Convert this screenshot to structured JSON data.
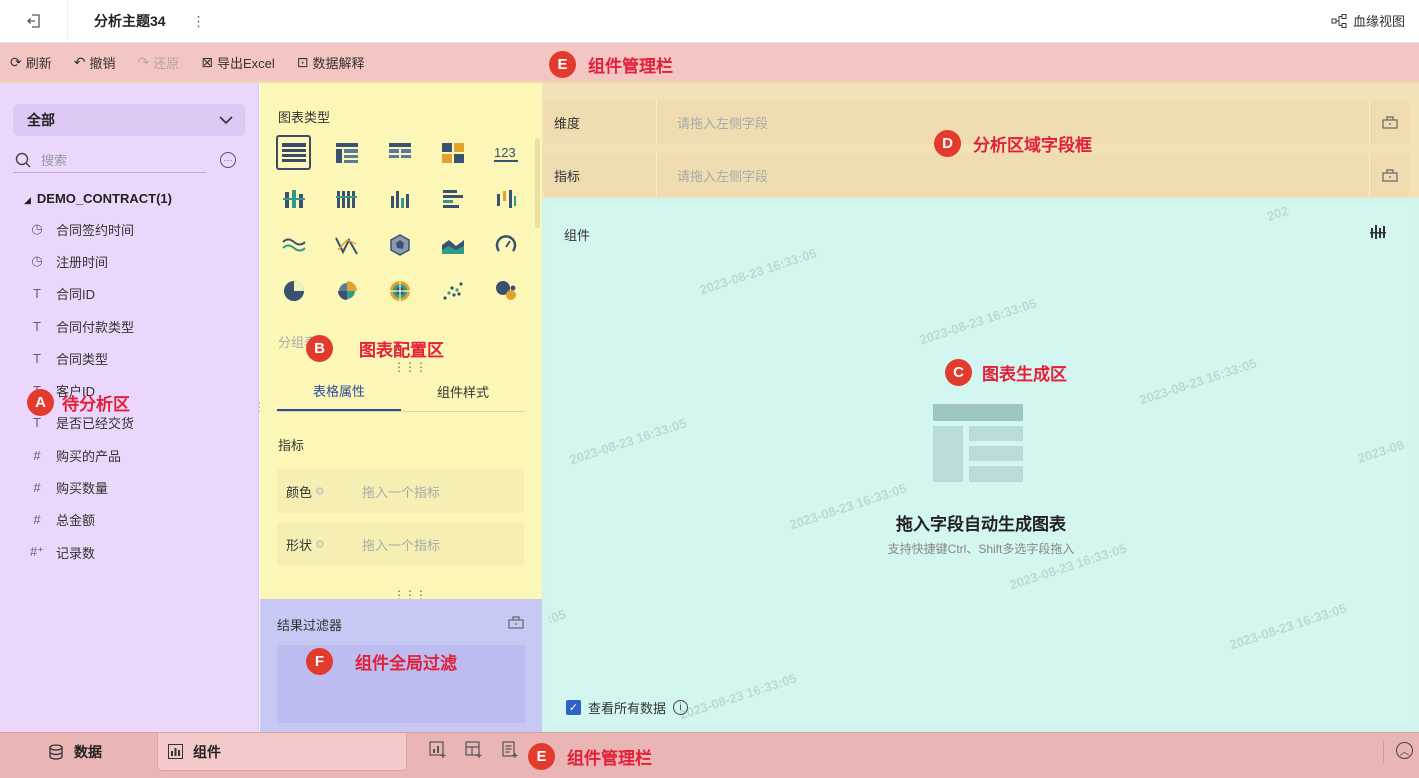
{
  "titlebar": {
    "title": "分析主题34",
    "more": "⋮",
    "lineage_label": "血缘视图"
  },
  "toolbar": {
    "items": [
      {
        "label": "刷新",
        "icon": "refresh-icon",
        "enabled": true
      },
      {
        "label": "撤销",
        "icon": "undo-icon",
        "enabled": true
      },
      {
        "label": "还原",
        "icon": "redo-icon",
        "enabled": false
      },
      {
        "label": "导出Excel",
        "icon": "excel-icon",
        "enabled": true
      },
      {
        "label": "数据解释",
        "icon": "explain-icon",
        "enabled": true
      }
    ]
  },
  "left_panel": {
    "scope_value": "全部",
    "search_placeholder": "搜索",
    "dataset": "DEMO_CONTRACT(1)",
    "fields": [
      {
        "label": "合同签约时间",
        "type": "time"
      },
      {
        "label": "注册时间",
        "type": "time"
      },
      {
        "label": "合同ID",
        "type": "text"
      },
      {
        "label": "合同付款类型",
        "type": "text"
      },
      {
        "label": "合同类型",
        "type": "text"
      },
      {
        "label": "客户ID",
        "type": "text"
      },
      {
        "label": "是否已经交货",
        "type": "text"
      },
      {
        "label": "购买的产品",
        "type": "number"
      },
      {
        "label": "购买数量",
        "type": "number"
      },
      {
        "label": "总金额",
        "type": "number"
      },
      {
        "label": "记录数",
        "type": "count"
      }
    ]
  },
  "config": {
    "chart_type_title": "图表类型",
    "group_label": "分组表",
    "tabs": [
      {
        "label": "表格属性",
        "active": true
      },
      {
        "label": "组件样式",
        "active": false
      }
    ],
    "metric_title": "指标",
    "slots": [
      {
        "label": "颜色",
        "placeholder": "拖入一个指标"
      },
      {
        "label": "形状",
        "placeholder": "拖入一个指标"
      }
    ]
  },
  "filter": {
    "title": "结果过滤器"
  },
  "fieldbox": {
    "rows": [
      {
        "label": "维度",
        "placeholder": "请拖入左侧字段"
      },
      {
        "label": "指标",
        "placeholder": "请拖入左侧字段"
      }
    ]
  },
  "chart_area": {
    "title": "组件",
    "empty_title": "拖入字段自动生成图表",
    "empty_sub": "支持快捷键Ctrl、Shift多选字段拖入",
    "view_all": "查看所有数据",
    "watermark": "2023-08-23 16:33:05",
    "watermark_partial_1": "202",
    "watermark_partial_2": "2023-08",
    "watermark_partial_3": ":05"
  },
  "bottombar": {
    "tabs": [
      {
        "label": "数据",
        "active": false
      },
      {
        "label": "组件",
        "active": true
      }
    ]
  },
  "annotations": {
    "A": {
      "badge": "A",
      "text": "待分析区"
    },
    "B": {
      "badge": "B",
      "text": "图表配置区"
    },
    "C": {
      "badge": "C",
      "text": "图表生成区"
    },
    "D": {
      "badge": "D",
      "text": "分析区域字段框"
    },
    "E_top": {
      "badge": "E",
      "text": "组件管理栏"
    },
    "E_bottom": {
      "badge": "E",
      "text": "组件管理栏"
    },
    "F": {
      "badge": "F",
      "text": "组件全局过滤"
    }
  },
  "colors": {
    "zone_a": "#ead7fb",
    "zone_b": "#fdf7b7",
    "zone_c": "#d0f4ee",
    "zone_d": "#f3e2b5",
    "zone_e": "#f4c6c3",
    "zone_f": "#c8c8f4",
    "annotation_red": "#e33a2e",
    "accent_blue": "#2b4a9a"
  }
}
